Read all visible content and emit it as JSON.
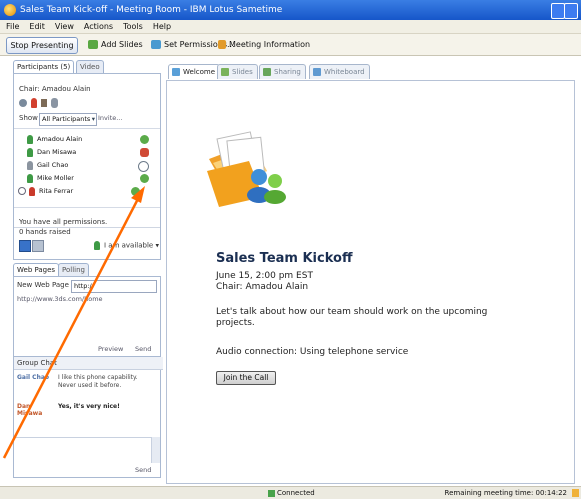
{
  "window": {
    "title": "Sales Team Kick-off - Meeting Room - IBM Lotus Sametime"
  },
  "menu": [
    "File",
    "Edit",
    "View",
    "Actions",
    "Tools",
    "Help"
  ],
  "toolbar": {
    "stop": "Stop Presenting",
    "add_slides": "Add Slides",
    "permissions": "Set Permissions...",
    "meeting_info": "Meeting Information"
  },
  "left": {
    "tabs": {
      "participants": "Participants (5)",
      "video": "Video"
    },
    "chair": "Chair: Amadou Alain",
    "show_label": "Show",
    "show_value": "All Participants",
    "invite": "Invite...",
    "participants": [
      "Amadou Alain",
      "Dan Misawa",
      "Gail Chao",
      "Mike Moller",
      "Rita Ferrar"
    ],
    "perm_text": "You have all permissions.",
    "hands_raised": "0 hands raised",
    "availability": "I am available",
    "web_tabs": {
      "web_pages": "Web Pages",
      "polling": "Polling"
    },
    "new_web_page_label": "New Web Page",
    "new_web_page_value": "http://",
    "url_item": "http://www.3ds.com/home",
    "preview": "Preview",
    "send": "Send",
    "chat_title": "Group Chat",
    "chat": [
      {
        "name": "Gail Chao",
        "msg": "I like this phone capability. Never used it before."
      },
      {
        "name": "Dan Misawa",
        "msg": "Yes, it's very nice!"
      }
    ],
    "chat_send": "Send"
  },
  "right": {
    "tabs": [
      "Welcome",
      "Slides",
      "Sharing",
      "Whiteboard"
    ],
    "heading": "Sales Team Kickoff",
    "date": "June 15, 2:00 pm EST",
    "chair": "Chair: Amadou Alain",
    "line1": "Let's talk about how our team should work on the upcoming",
    "line2": "projects.",
    "audio": "Audio connection: Using telephone service",
    "join": "Join the Call"
  },
  "status": {
    "connected": "Connected",
    "remaining": "Remaining meeting time: 00:14:22"
  }
}
